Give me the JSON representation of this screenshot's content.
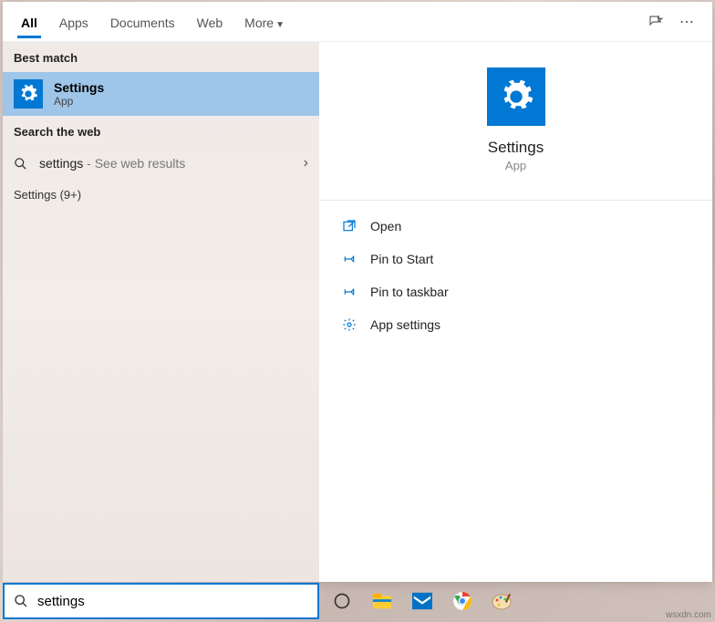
{
  "tabs": {
    "all": "All",
    "apps": "Apps",
    "documents": "Documents",
    "web": "Web",
    "more": "More"
  },
  "sections": {
    "best": "Best match",
    "web": "Search the web",
    "category": "Settings (9+)"
  },
  "best": {
    "title": "Settings",
    "subtitle": "App"
  },
  "webresult": {
    "term": "settings",
    "suffix": " - See web results"
  },
  "preview": {
    "title": "Settings",
    "subtitle": "App"
  },
  "actions": {
    "open": "Open",
    "pinstart": "Pin to Start",
    "pintaskbar": "Pin to taskbar",
    "appsettings": "App settings"
  },
  "search": {
    "value": "settings"
  },
  "watermark": "wsxdn.com"
}
